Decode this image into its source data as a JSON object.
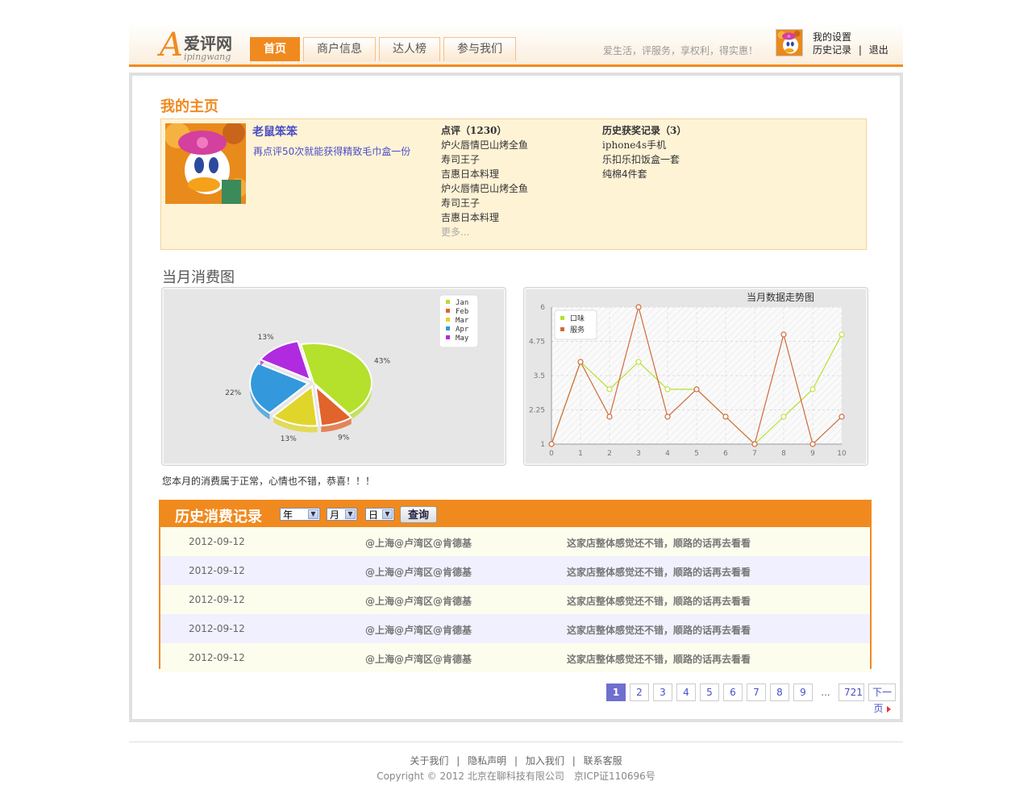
{
  "logo": {
    "letter": "A",
    "cn": "爱评网",
    "en": "ipingwang"
  },
  "nav": {
    "tabs": [
      {
        "label": "首页",
        "active": true
      },
      {
        "label": "商户信息",
        "active": false
      },
      {
        "label": "达人榜",
        "active": false
      },
      {
        "label": "参与我们",
        "active": false
      }
    ]
  },
  "slogan": "爱生活，评服务，享权利，得实惠！",
  "user_links": {
    "settings": "我的设置",
    "history": "历史记录",
    "sep": "|",
    "logout": "退出"
  },
  "main": {
    "title": "我的主页"
  },
  "profile": {
    "name": "老鼠笨笨",
    "tip": "再点评50次就能获得精致毛巾盒一份",
    "reviews": {
      "heading": "点评（1230）",
      "items": [
        "炉火唇情巴山烤全鱼",
        "寿司王子",
        "吉惠日本料理",
        "炉火唇情巴山烤全鱼",
        "寿司王子",
        "吉惠日本料理"
      ],
      "more": "更多..."
    },
    "awards": {
      "heading": "历史获奖记录（3）",
      "items": [
        "iphone4s手机",
        "乐扣乐扣饭盒一套",
        "纯棉4件套"
      ]
    }
  },
  "monthly": {
    "title": "当月消费图",
    "summary": "您本月的消费属于正常，心情也不错，恭喜！！！"
  },
  "chart_data": [
    {
      "type": "pie",
      "categories": [
        "Jan",
        "Feb",
        "Mar",
        "Apr",
        "May"
      ],
      "values": [
        43,
        9,
        13,
        22,
        13
      ],
      "labels": [
        "43%",
        "9%",
        "13%",
        "22%",
        "13%"
      ],
      "colors": [
        "#b5e02b",
        "#e0642b",
        "#e0d52b",
        "#3398dc",
        "#b02be0"
      ],
      "legend": "top-right"
    },
    {
      "type": "line",
      "title": "当月数据走势图",
      "x": [
        0,
        1,
        2,
        3,
        4,
        5,
        6,
        7,
        8,
        9,
        10
      ],
      "xlim": [
        0,
        10
      ],
      "ylim": [
        1,
        6
      ],
      "yticks": [
        "1",
        "2.25",
        "3.5",
        "4.75",
        "6"
      ],
      "series": [
        {
          "name": "口味",
          "color": "#b5e02b",
          "values": [
            1,
            4,
            3,
            4,
            3,
            3,
            2,
            1,
            2,
            3,
            5
          ]
        },
        {
          "name": "服务",
          "color": "#d06a3a",
          "values": [
            1,
            4,
            2,
            6,
            2,
            3,
            2,
            1,
            5,
            1,
            2
          ]
        }
      ],
      "legend": "top-left",
      "grid": true
    }
  ],
  "history": {
    "title": "历史消费记录",
    "year": "年",
    "month": "月",
    "day": "日",
    "query": "查询",
    "rows": [
      {
        "date": "2012-09-12",
        "place": "@上海@卢湾区@肯德基",
        "comment": "这家店整体感觉还不错，顺路的话再去看看"
      },
      {
        "date": "2012-09-12",
        "place": "@上海@卢湾区@肯德基",
        "comment": "这家店整体感觉还不错，顺路的话再去看看"
      },
      {
        "date": "2012-09-12",
        "place": "@上海@卢湾区@肯德基",
        "comment": "这家店整体感觉还不错，顺路的话再去看看"
      },
      {
        "date": "2012-09-12",
        "place": "@上海@卢湾区@肯德基",
        "comment": "这家店整体感觉还不错，顺路的话再去看看"
      },
      {
        "date": "2012-09-12",
        "place": "@上海@卢湾区@肯德基",
        "comment": "这家店整体感觉还不错，顺路的话再去看看"
      }
    ]
  },
  "pager": {
    "pages": [
      "1",
      "2",
      "3",
      "4",
      "5",
      "6",
      "7",
      "8",
      "9"
    ],
    "current": "1",
    "dots": "...",
    "last": "721",
    "next": "下一页"
  },
  "footer": {
    "links": [
      "关于我们",
      "隐私声明",
      "加入我们",
      "联系客服"
    ],
    "sep": "|",
    "copyright": "Copyright © 2012 北京在聊科技有限公司　京ICP证110696号"
  },
  "colors": {
    "accent": "#f08a1f",
    "link": "#4a4ec7",
    "profile_bg": "#fff3d6"
  },
  "icons": {
    "avatar": "daisy-duck-avatar",
    "next": "triangle-right-icon"
  }
}
